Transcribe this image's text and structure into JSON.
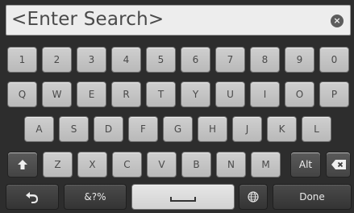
{
  "search": {
    "placeholder": "<Enter Search>"
  },
  "keyboard": {
    "row_numbers": [
      "1",
      "2",
      "3",
      "4",
      "5",
      "6",
      "7",
      "8",
      "9",
      "0"
    ],
    "row_qwerty": [
      "Q",
      "W",
      "E",
      "R",
      "T",
      "Y",
      "U",
      "I",
      "O",
      "P"
    ],
    "row_asdf": [
      "A",
      "S",
      "D",
      "F",
      "G",
      "H",
      "J",
      "K",
      "L"
    ],
    "row_zxcv": [
      "Z",
      "X",
      "C",
      "V",
      "B",
      "N",
      "M"
    ],
    "alt_label": "Alt",
    "symbols_label": "&?%",
    "done_label": "Done",
    "icons": {
      "shift": "shift-icon",
      "backspace": "backspace-icon",
      "back": "back-arrow-icon",
      "space": "space-icon",
      "globe": "globe-icon",
      "clear": "clear-icon"
    }
  }
}
